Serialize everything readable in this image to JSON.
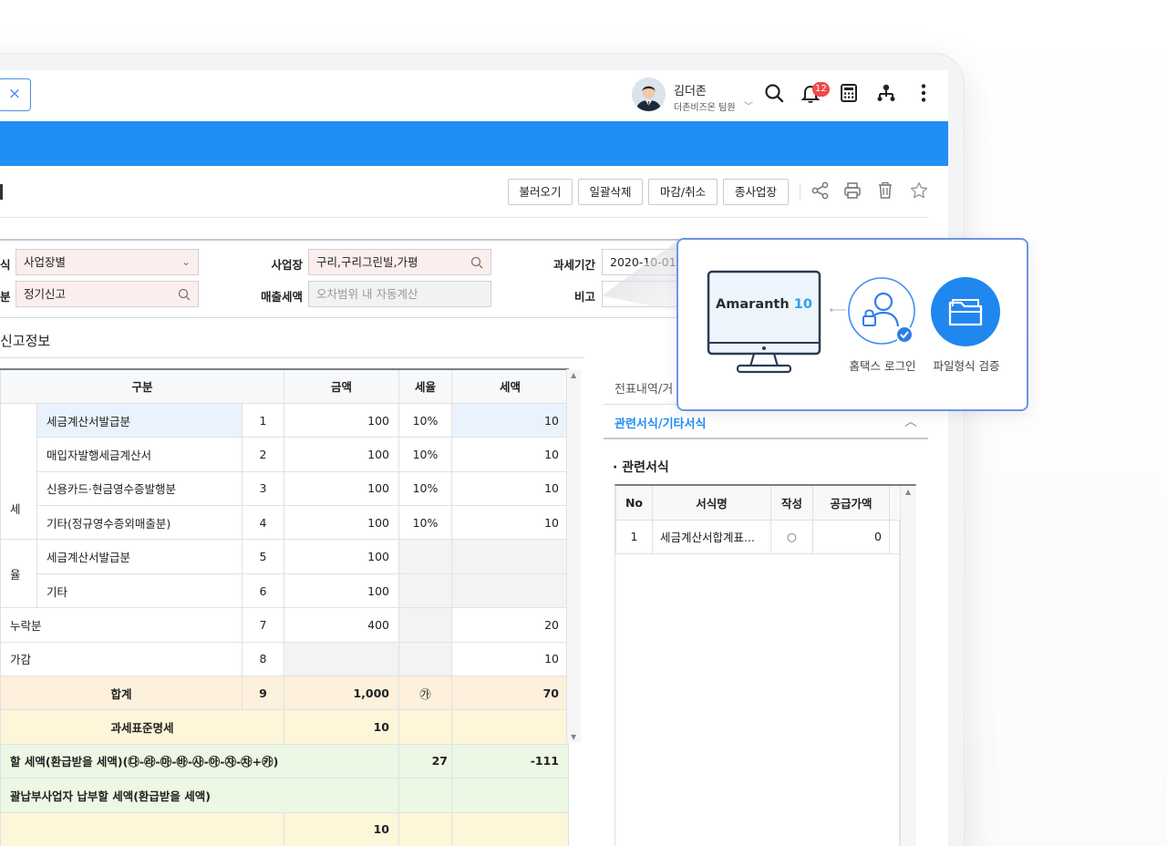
{
  "header": {
    "tab_close": "×",
    "user_name": "김더존",
    "user_team": "더존비즈온 팀원",
    "user_chevron": "﹀",
    "notification_count": "12"
  },
  "toolbar": {
    "load_label": "불러오기",
    "bulk_delete_label": "일괄삭제",
    "close_cancel_label": "마감/취소",
    "sub_business_label": "종사업장"
  },
  "filters": {
    "method_label": "식",
    "method_value": "사업장별",
    "division_label": "분",
    "division_value": "정기신고",
    "site_label": "사업장",
    "site_value": "구리,구리그린빌,가평",
    "sales_tax_label": "매출세액",
    "sales_tax_placeholder": "오차범위 내 자동계산",
    "period_label": "과세기간",
    "period_value": "2020-10-01",
    "note_label": "비고"
  },
  "section_title": "신고정보",
  "main_table": {
    "headers": [
      "구분",
      "금액",
      "세율",
      "세액"
    ],
    "side_labels": [
      "",
      "율"
    ],
    "rows": [
      {
        "group": "",
        "label": "세금계산서발급분",
        "no": "1",
        "amount": "100",
        "rate": "10%",
        "tax": "10"
      },
      {
        "group": "세",
        "label": "매입자발행세금계산서",
        "no": "2",
        "amount": "100",
        "rate": "10%",
        "tax": "10"
      },
      {
        "group": "",
        "label": "신용카드·현금영수증발행분",
        "no": "3",
        "amount": "100",
        "rate": "10%",
        "tax": "10"
      },
      {
        "group": "",
        "label": "기타(정규영수증외매출분)",
        "no": "4",
        "amount": "100",
        "rate": "10%",
        "tax": "10"
      },
      {
        "group": "",
        "label": "세금계산서발급분",
        "no": "5",
        "amount": "100",
        "rate": "",
        "tax": ""
      },
      {
        "group": "율",
        "label": "기타",
        "no": "6",
        "amount": "100",
        "rate": "",
        "tax": ""
      },
      {
        "group": "",
        "label": "누락분",
        "no": "7",
        "amount": "400",
        "rate": "",
        "tax": "20"
      },
      {
        "group": "",
        "label": "가감",
        "no": "8",
        "amount": "",
        "rate": "",
        "tax": "10"
      }
    ],
    "total": {
      "label": "합계",
      "no": "9",
      "amount": "1,000",
      "rate": "㉮",
      "tax": "70"
    },
    "tax_base": {
      "label": "과세표준명세",
      "amount": "10"
    },
    "payable": {
      "label": "할 세액(환급받을 세액)(㉰-㉱-㉲-㉳-㉴-㉵-㉶-㉷+㉸)",
      "rate": "27",
      "tax": "-111"
    },
    "consolidated": {
      "label": "괄납부사업자 납부할 세액(환급받을 세액)"
    },
    "last": {
      "amount": "10"
    }
  },
  "right_panel": {
    "tab_label": "전표내역/거",
    "accordion_title": "관련서식/기타서식",
    "accordion_chevron": "︿",
    "sub_title": "· 관련서식",
    "headers": [
      "No",
      "서식명",
      "작성",
      "공급가액"
    ],
    "rows": [
      {
        "no": "1",
        "name": "세금계산서합계표...",
        "written": "○",
        "amount": "0"
      }
    ]
  },
  "popup": {
    "brand_name": "Amaranth",
    "brand_version": "10",
    "login_label": "홈택스 로그인",
    "file_label": "파일형식 검증"
  },
  "colors": {
    "accent_blue": "#1f8ef5",
    "popup_border": "#6f93e8",
    "required_field": "#fdeeee",
    "total_row": "#fdf0dc"
  }
}
